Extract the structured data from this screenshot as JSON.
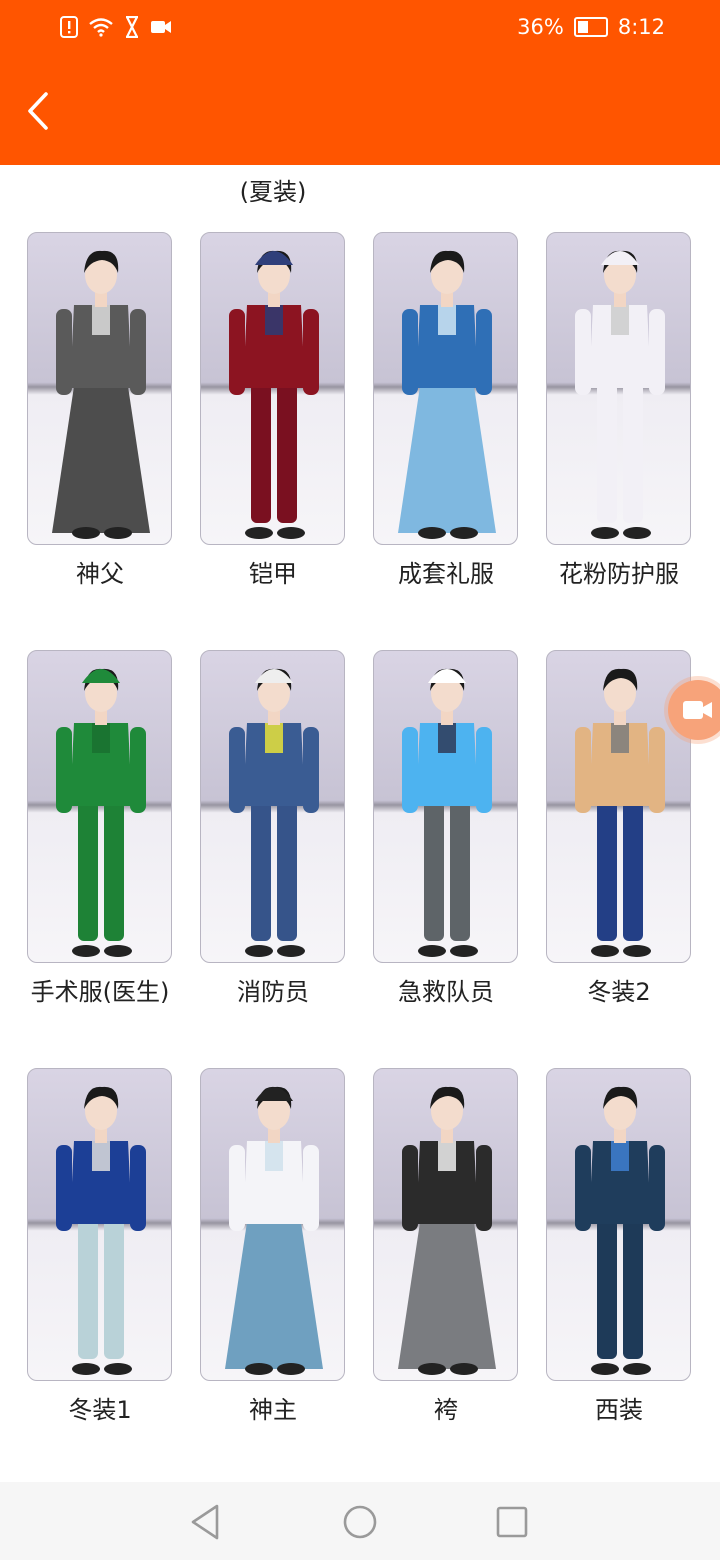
{
  "status": {
    "battery": "36%",
    "time": "8:12"
  },
  "header": {
    "back_icon": "chevron-left-icon"
  },
  "partial_row": {
    "visible_label": "(夏装)"
  },
  "costumes": [
    {
      "name": "神父",
      "figure": "priest"
    },
    {
      "name": "铠甲",
      "figure": "armor"
    },
    {
      "name": "成套礼服",
      "figure": "formal"
    },
    {
      "name": "花粉防护服",
      "figure": "protective"
    },
    {
      "name": "手术服(医生)",
      "figure": "surgeon"
    },
    {
      "name": "消防员",
      "figure": "firefighter"
    },
    {
      "name": "急救队员",
      "figure": "paramedic"
    },
    {
      "name": "冬装2",
      "figure": "winter2"
    },
    {
      "name": "冬装1",
      "figure": "winter1"
    },
    {
      "name": "神主",
      "figure": "shinto"
    },
    {
      "name": "袴",
      "figure": "hakama"
    },
    {
      "name": "西装",
      "figure": "suit"
    }
  ],
  "colors": {
    "header": "#ff5500",
    "fab": "#f7a37a"
  }
}
